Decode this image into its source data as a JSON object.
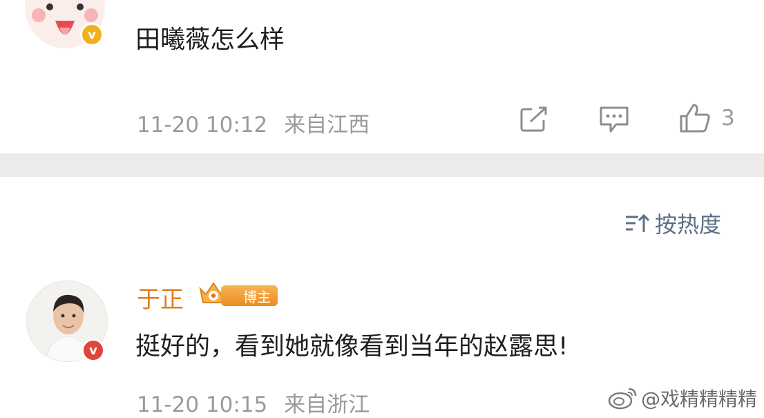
{
  "first_comment": {
    "text": "田曦薇怎么样",
    "time": "11-20 10:12",
    "location": "来自江西",
    "like_count": "3",
    "verified_badge_color": "#f2b01e"
  },
  "sort": {
    "label": "按热度"
  },
  "second_comment": {
    "username": "于正",
    "user_badge_label": "博主",
    "text": "挺好的，看到她就像看到当年的赵露思!",
    "time": "11-20 10:15",
    "location": "来自浙江",
    "verified_badge_color": "#e0443a"
  },
  "watermark": {
    "text": "@戏精精精精"
  },
  "colors": {
    "username": "#e27b1c",
    "meta_text": "#9a9a9a",
    "sort_text": "#5b6f86",
    "divider": "#ebebeb"
  },
  "icons": [
    "share-icon",
    "comment-icon",
    "like-icon",
    "sort-icon",
    "weibo-logo-icon"
  ]
}
